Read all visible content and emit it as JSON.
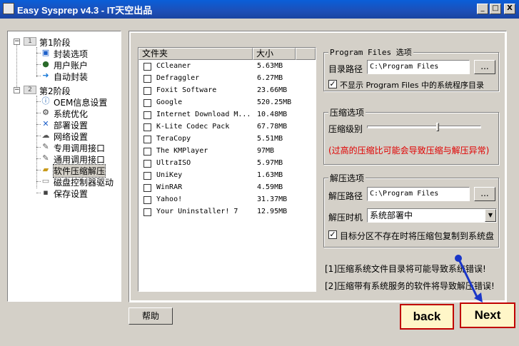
{
  "window": {
    "title": "Easy Sysprep v4.3 - IT天空出品",
    "controls": [
      "_",
      "□",
      "X"
    ]
  },
  "tree": {
    "stage1": {
      "badge": "1",
      "label": "第1阶段",
      "expanded": "−"
    },
    "stage1_items": [
      {
        "label": "封装选项",
        "icon": "monitor-icon"
      },
      {
        "label": "用户账户",
        "icon": "user-icon"
      },
      {
        "label": "自动封装",
        "icon": "arrow-icon"
      }
    ],
    "stage2": {
      "badge": "2",
      "label": "第2阶段",
      "expanded": "−"
    },
    "stage2_items": [
      {
        "label": "OEM信息设置",
        "icon": "info-icon"
      },
      {
        "label": "系统优化",
        "icon": "gear-icon"
      },
      {
        "label": "部署设置",
        "icon": "tools-icon"
      },
      {
        "label": "网络设置",
        "icon": "network-icon"
      },
      {
        "label": "专用调用接口",
        "icon": "pencil-icon"
      },
      {
        "label": "通用调用接口",
        "icon": "pencil-icon"
      },
      {
        "label": "软件压缩解压",
        "icon": "folder-icon"
      },
      {
        "label": "磁盘控制器驱动",
        "icon": "disk-icon"
      },
      {
        "label": "保存设置",
        "icon": "save-icon"
      }
    ]
  },
  "list": {
    "headers": {
      "name": "文件夹",
      "size": "大小"
    },
    "rows": [
      {
        "name": "CCleaner",
        "size": "5.63MB"
      },
      {
        "name": "Defraggler",
        "size": "6.27MB"
      },
      {
        "name": "Foxit Software",
        "size": "23.66MB"
      },
      {
        "name": "Google",
        "size": "520.25MB"
      },
      {
        "name": "Internet Download M...",
        "size": "10.48MB"
      },
      {
        "name": "K-Lite Codec Pack",
        "size": "67.78MB"
      },
      {
        "name": "TeraCopy",
        "size": "5.51MB"
      },
      {
        "name": "The KMPlayer",
        "size": "97MB"
      },
      {
        "name": "UltraISO",
        "size": "5.97MB"
      },
      {
        "name": "UniKey",
        "size": "1.63MB"
      },
      {
        "name": "WinRAR",
        "size": "4.59MB"
      },
      {
        "name": "Yahoo!",
        "size": "31.37MB"
      },
      {
        "name": "Your Uninstaller! 7",
        "size": "12.95MB"
      }
    ]
  },
  "program_files": {
    "legend": "Program Files 选项",
    "path_label": "目录路径",
    "path_value": "C:\\Program Files",
    "browse": "...",
    "hide_label": "不显示 Program Files 中的系统程序目录",
    "hide_checked": "✓"
  },
  "compression": {
    "legend": "压缩选项",
    "level_label": "压缩级别",
    "level_fraction": 0.62,
    "warning": "(过高的压缩比可能会导致压缩与解压异常)"
  },
  "decompression": {
    "legend": "解压选项",
    "path_label": "解压路径",
    "path_value": "C:\\Program Files",
    "browse": "...",
    "timing_label": "解压时机",
    "timing_value": "系统部署中",
    "copy_label": "目标分区不存在时将压缩包复制到系统盘",
    "copy_checked": "✓"
  },
  "notes": [
    "[1]压缩系统文件目录将可能导致系统错误!",
    "[2]压缩带有系统服务的软件将导致解压错误!"
  ],
  "help_button": "帮助",
  "nav": {
    "back": "back",
    "next": "Next"
  }
}
